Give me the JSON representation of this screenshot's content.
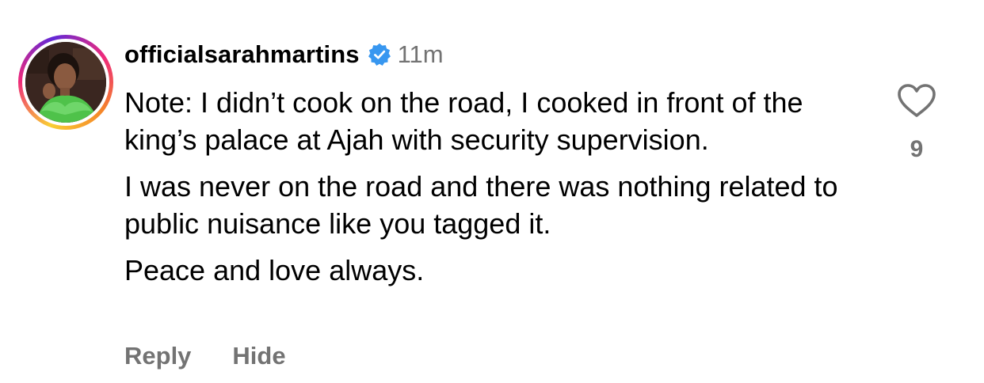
{
  "comment": {
    "username": "officialsarahmartins",
    "verified_icon": "verified-badge-icon",
    "timestamp": "11m",
    "paragraphs": [
      "Note: I didn’t cook on the road, I cooked in front of the king’s palace at Ajah with security supervision.",
      "I was never on the road and there was nothing related to public nuisance like you tagged it.",
      "Peace and love always."
    ],
    "actions": {
      "reply_label": "Reply",
      "hide_label": "Hide"
    },
    "like": {
      "icon": "heart-outline-icon",
      "count": "9"
    }
  },
  "colors": {
    "verified_blue": "#3897f0",
    "secondary_text": "#737373",
    "primary_text": "#000000"
  }
}
